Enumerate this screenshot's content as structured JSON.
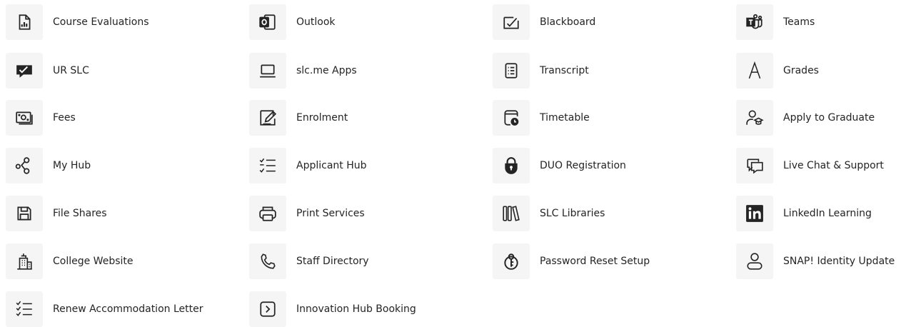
{
  "apps": [
    {
      "label": "Course Evaluations",
      "icon": "report-chart-icon"
    },
    {
      "label": "Outlook",
      "icon": "outlook-icon"
    },
    {
      "label": "Blackboard",
      "icon": "blackboard-icon"
    },
    {
      "label": "Teams",
      "icon": "teams-icon"
    },
    {
      "label": "UR SLC",
      "icon": "chat-check-icon"
    },
    {
      "label": "slc.me Apps",
      "icon": "laptop-icon"
    },
    {
      "label": "Transcript",
      "icon": "transcript-list-icon"
    },
    {
      "label": "Grades",
      "icon": "letter-a-icon"
    },
    {
      "label": "Fees",
      "icon": "money-icon"
    },
    {
      "label": "Enrolment",
      "icon": "edit-form-icon"
    },
    {
      "label": "Timetable",
      "icon": "calendar-clock-icon"
    },
    {
      "label": "Apply to Graduate",
      "icon": "person-graduation-icon"
    },
    {
      "label": "My Hub",
      "icon": "hub-nodes-icon"
    },
    {
      "label": "Applicant Hub",
      "icon": "checklist-icon"
    },
    {
      "label": "DUO Registration",
      "icon": "lock-shield-icon"
    },
    {
      "label": "Live Chat & Support",
      "icon": "chat-bubbles-icon"
    },
    {
      "label": "File Shares",
      "icon": "save-disk-icon"
    },
    {
      "label": "Print Services",
      "icon": "printer-icon"
    },
    {
      "label": "SLC Libraries",
      "icon": "library-books-icon"
    },
    {
      "label": "LinkedIn Learning",
      "icon": "linkedin-icon"
    },
    {
      "label": "College Website",
      "icon": "building-icon"
    },
    {
      "label": "Staff Directory",
      "icon": "phone-icon"
    },
    {
      "label": "Password Reset Setup",
      "icon": "key-reset-icon"
    },
    {
      "label": "SNAP! Identity Update",
      "icon": "person-outline-icon"
    },
    {
      "label": "Renew Accommodation Letter",
      "icon": "list-check-icon"
    },
    {
      "label": "Innovation Hub Booking",
      "icon": "chevron-right-box-icon"
    }
  ]
}
